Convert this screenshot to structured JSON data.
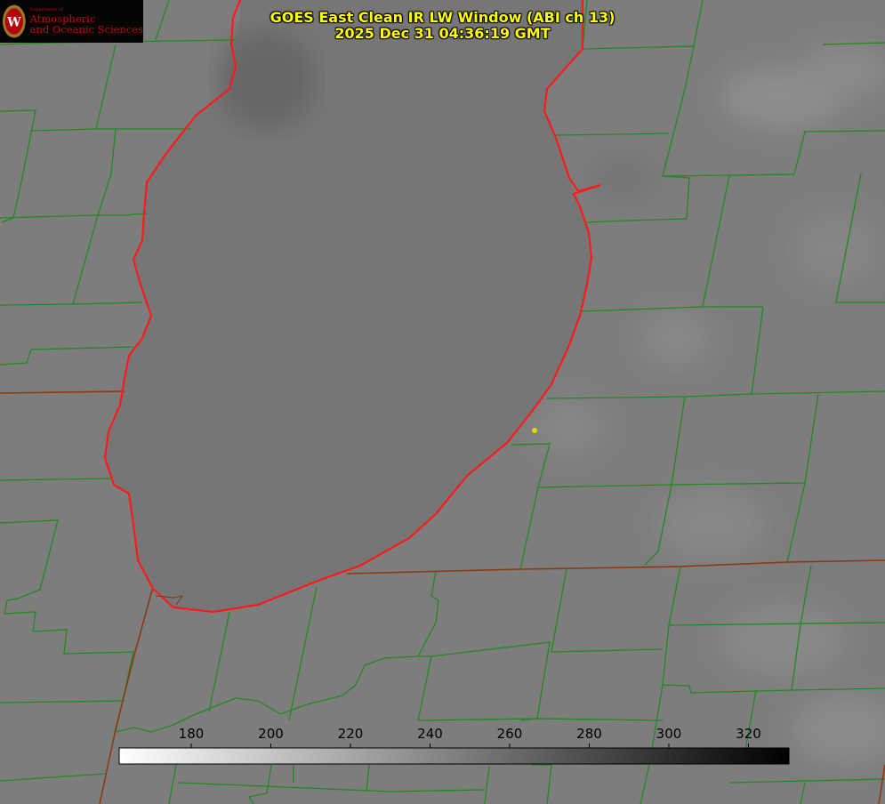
{
  "map": {
    "title_line1": "GOES East Clean IR LW Window (ABI ch 13)",
    "title_line2": "2025 Dec 31 04:36:19 GMT",
    "logo": {
      "dept": "Department of",
      "name_line1": "Atmospheric",
      "name_line2": "and Oceanic Sciences"
    },
    "colors": {
      "background": "#7d7d7d",
      "lake": "#767676",
      "county_lines": "#1f8a1f",
      "state_lines": "#8b3a10",
      "shoreline": "#ff1a1a",
      "title": "#ffff00",
      "marker": "#e5d400"
    },
    "colorbar": {
      "ticks": [
        "180",
        "200",
        "220",
        "240",
        "260",
        "280",
        "300",
        "320"
      ],
      "gradient_start": "#ffffff",
      "gradient_end": "#000000"
    }
  }
}
